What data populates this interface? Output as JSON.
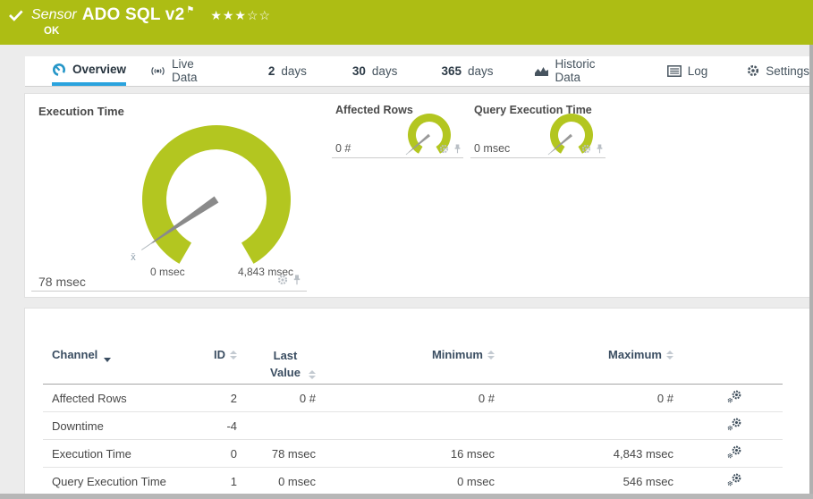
{
  "colors": {
    "header_green": "#adbd14",
    "gauge_green": "#b3c620",
    "active_tab_blue": "#2aa3de",
    "slate_icon": "#3d4d5b"
  },
  "header": {
    "type_label": "Sensor",
    "title": "ADO SQL v2",
    "status": "OK",
    "flag_icon": "⚑",
    "stars_filled": "★★★",
    "stars_empty": "☆☆",
    "rating": {
      "filled": 3,
      "total": 5
    }
  },
  "tabs": [
    {
      "label": "Overview",
      "active": true
    },
    {
      "label": "Live Data"
    },
    {
      "num": "2",
      "label": "days"
    },
    {
      "num": "30",
      "label": "days"
    },
    {
      "num": "365",
      "label": "days"
    },
    {
      "label": "Historic Data"
    },
    {
      "label": "Log"
    },
    {
      "label": "Settings"
    }
  ],
  "gauges": {
    "primary": {
      "title": "Execution Time",
      "value": "78 msec",
      "min_label": "0 msec",
      "max_label": "4,843 msec",
      "mean_marker": "x̄"
    },
    "secondary": [
      {
        "title": "Affected Rows",
        "value": "0 #"
      },
      {
        "title": "Query Execution Time",
        "value": "0 msec"
      }
    ]
  },
  "table": {
    "headers": {
      "channel": "Channel",
      "id": "ID",
      "last": "Last Value",
      "min": "Minimum",
      "max": "Maximum"
    },
    "rows": [
      {
        "channel": "Affected Rows",
        "id": "2",
        "last": "0 #",
        "min": "0 #",
        "max": "0 #"
      },
      {
        "channel": "Downtime",
        "id": "-4",
        "last": "",
        "min": "",
        "max": ""
      },
      {
        "channel": "Execution Time",
        "id": "0",
        "last": "78 msec",
        "min": "16 msec",
        "max": "4,843 msec"
      },
      {
        "channel": "Query Execution Time",
        "id": "1",
        "last": "0 msec",
        "min": "0 msec",
        "max": "546 msec"
      }
    ]
  }
}
